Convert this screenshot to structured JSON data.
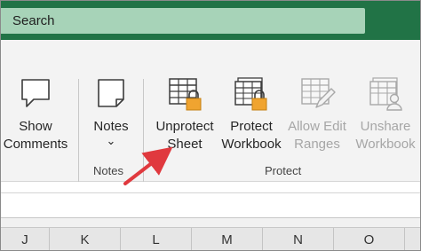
{
  "search": {
    "placeholder": "Search"
  },
  "ribbon": {
    "show_comments": {
      "line1": "Show",
      "line2": "Comments"
    },
    "notes": {
      "line1": "Notes",
      "dropdown": "⌄"
    },
    "notes_group_label": "Notes",
    "unprotect_sheet": {
      "line1": "Unprotect",
      "line2": "Sheet"
    },
    "protect_workbook": {
      "line1": "Protect",
      "line2": "Workbook"
    },
    "allow_edit_ranges": {
      "line1": "Allow Edit",
      "line2": "Ranges"
    },
    "unshare_workbook": {
      "line1": "Unshare",
      "line2": "Workbook"
    },
    "protect_group_label": "Protect"
  },
  "columns": [
    "J",
    "K",
    "L",
    "M",
    "N",
    "O"
  ],
  "colors": {
    "titlebar": "#217346",
    "search_bg": "#a7d3b8",
    "lock": "#f0a430",
    "arrow": "#e0393e"
  }
}
